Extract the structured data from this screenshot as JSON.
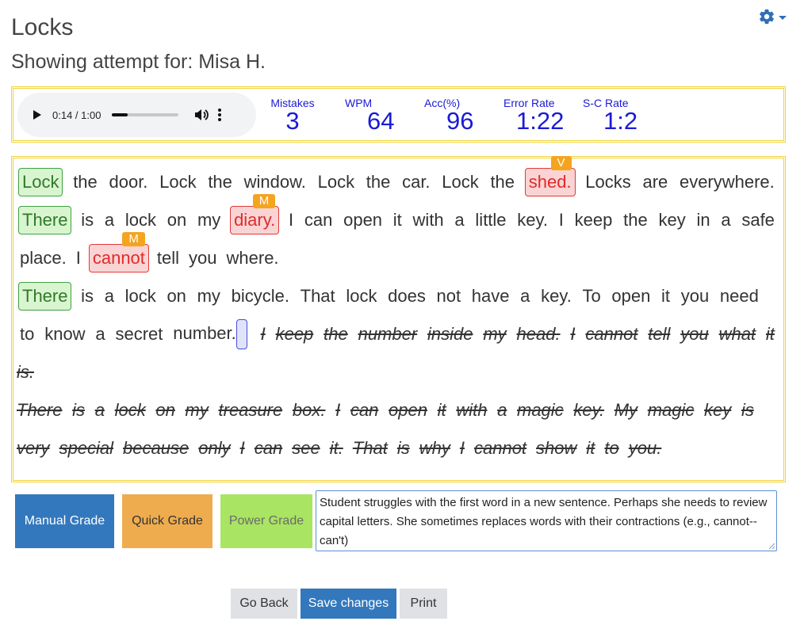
{
  "page": {
    "title": "Locks",
    "subtitle": "Showing attempt for: Misa H."
  },
  "audio": {
    "time": "0:14 / 1:00",
    "progress_fraction": 0.233
  },
  "stats": [
    {
      "label": "Mistakes",
      "value": "3"
    },
    {
      "label": "WPM",
      "value": "64"
    },
    {
      "label": "Acc(%)",
      "value": "96"
    },
    {
      "label": "Error Rate",
      "value": "1:22"
    },
    {
      "label": "S-C Rate",
      "value": "1:2"
    }
  ],
  "passage": {
    "line1": {
      "w1": "Lock",
      "w2": "the",
      "w3": "door.",
      "w4": "Lock",
      "w5": "the",
      "w6": "window.",
      "w7": "Lock",
      "w8": "the",
      "w9": "car.",
      "w10": "Lock",
      "w11": "the",
      "w12": "shed.",
      "w12_tag": "V",
      "w13": "Locks",
      "w14": "are",
      "w15": "everywhere."
    },
    "line2": {
      "w1": "There",
      "w2": "is",
      "w3": "a",
      "w4": "lock",
      "w5": "on",
      "w6": "my",
      "w7": "diary.",
      "w7_tag": "M",
      "w8": "I",
      "w9": "can",
      "w10": "open",
      "w11": "it",
      "w12": "with",
      "w13": "a",
      "w14": "little",
      "w15": "key.",
      "w16": "I",
      "w17": "keep",
      "w18": "the",
      "w19": "key",
      "w20": "in",
      "w21": "a",
      "w22": "safe"
    },
    "line3": {
      "w1": "place.",
      "w2": "I",
      "w3": "cannot",
      "w3_tag": "M",
      "w4": "tell",
      "w5": "you",
      "w6": "where."
    },
    "line4": {
      "w1": "There",
      "w2": "is",
      "w3": "a",
      "w4": "lock",
      "w5": "on",
      "w6": "my",
      "w7": "bicycle.",
      "w8": "That",
      "w9": "lock",
      "w10": "does",
      "w11": "not",
      "w12": "have",
      "w13": "a",
      "w14": "key.",
      "w15": "To",
      "w16": "open",
      "w17": "it",
      "w18": "you",
      "w19": "need"
    },
    "line5": {
      "w1": "to",
      "w2": "know",
      "w3": "a",
      "w4": "secret",
      "w5": "number.",
      "s1": "I",
      "s2": "keep",
      "s3": "the",
      "s4": "number",
      "s5": "inside",
      "s6": "my",
      "s7": "head.",
      "s8": "I",
      "s9": "cannot",
      "s10": "tell",
      "s11": "you",
      "s12": "what",
      "s13": "it"
    },
    "line6": {
      "s1": "is."
    },
    "line7": {
      "s1": "There",
      "s2": "is",
      "s3": "a",
      "s4": "lock",
      "s5": "on",
      "s6": "my",
      "s7": "treasure",
      "s8": "box.",
      "s9": "I",
      "s10": "can",
      "s11": "open",
      "s12": "it",
      "s13": "with",
      "s14": "a",
      "s15": "magic",
      "s16": "key.",
      "s17": "My",
      "s18": "magic",
      "s19": "key",
      "s20": "is"
    },
    "line8": {
      "s1": "very",
      "s2": "special",
      "s3": "because",
      "s4": "only",
      "s5": "I",
      "s6": "can",
      "s7": "see",
      "s8": "it.",
      "s9": "That",
      "s10": "is",
      "s11": "why",
      "s12": "I",
      "s13": "cannot",
      "s14": "show",
      "s15": "it",
      "s16": "to",
      "s17": "you."
    }
  },
  "grade_buttons": {
    "manual": "Manual Grade",
    "quick": "Quick Grade",
    "power": "Power Grade"
  },
  "feedback": {
    "value": "Student struggles with the first word in a new sentence. Perhaps she needs to review capital letters. She sometimes replaces words with their contractions (e.g., cannot--can't)"
  },
  "actions": {
    "back": "Go Back",
    "save": "Save changes",
    "print": "Print"
  },
  "colors": {
    "accent": "#3378bd",
    "stat_text": "#1a1ad6",
    "box_border": "#f1d33a",
    "correct_bg": "#d9f5cf",
    "error_bg": "#fad4d4",
    "tag_bg": "#f4a41f"
  }
}
